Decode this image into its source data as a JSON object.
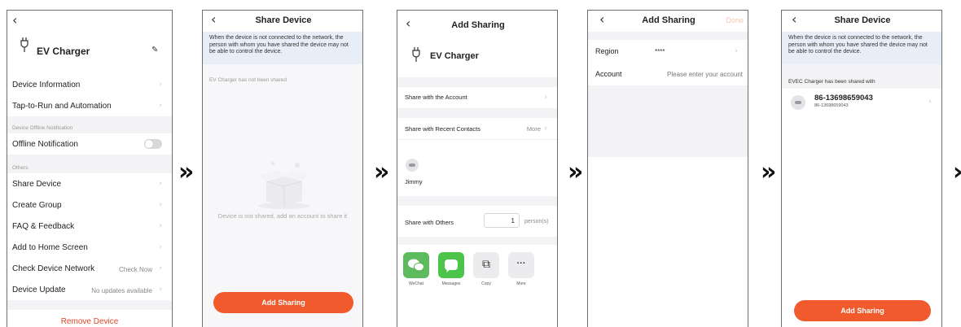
{
  "arrows": [
    "»",
    "»",
    "»",
    "»"
  ],
  "screen1": {
    "back": "‹",
    "device_name": "EV Charger",
    "edit_icon": "✎",
    "chev": "›",
    "items": [
      {
        "label": "Device Information"
      },
      {
        "label": "Tap-to-Run and Automation"
      }
    ],
    "offline_section": "Device Offline Notification",
    "offline_label": "Offline Notification",
    "others_section": "Others",
    "others": [
      {
        "label": "Share Device",
        "value": ""
      },
      {
        "label": "Create Group",
        "value": ""
      },
      {
        "label": "FAQ & Feedback",
        "value": ""
      },
      {
        "label": "Add to Home Screen",
        "value": ""
      },
      {
        "label": "Check Device Network",
        "value": "Check Now"
      },
      {
        "label": "Device Update",
        "value": "No updates available"
      }
    ],
    "remove": "Remove Device"
  },
  "screen2": {
    "back": "‹",
    "title": "Share Device",
    "notice": "When the device is not connected to the network, the person with whom you have shared the device may not be able to control the device.",
    "status": "EV Charger has not been shared",
    "empty": "Device is not shared, add an account to share it",
    "button": "Add Sharing"
  },
  "screen3": {
    "back": "‹",
    "title": "Add Sharing",
    "device_name": "EV Charger",
    "share_account": "Share with the Account",
    "recent": "Share with Recent Contacts",
    "more": "More",
    "contact": "Jimmy",
    "others": "Share with Others",
    "count": "1",
    "person": "person(s)",
    "apps": [
      {
        "label": "WeChat",
        "color": "#5dbb5d"
      },
      {
        "label": "Messages",
        "color": "#4cc44c"
      },
      {
        "label": "Copy",
        "color": "#ececef"
      },
      {
        "label": "More",
        "color": "#ececef"
      }
    ],
    "copy_glyph": "⧉",
    "more_glyph": "···"
  },
  "screen4": {
    "back": "‹",
    "title": "Add Sharing",
    "done": "Done",
    "region_label": "Region",
    "region_value": "****",
    "account_label": "Account",
    "account_placeholder": "Please enter your account"
  },
  "screen5": {
    "back": "‹",
    "title": "Share Device",
    "notice": "When the device is not connected to the network, the person with whom you have shared the device may not be able to control the device.",
    "status": "EVEC Charger has been shared with",
    "user_name": "86-13698659043",
    "user_sub": "86-13698659043",
    "button": "Add Sharing"
  },
  "colors": {
    "accent": "#f05a2c",
    "notice_bg": "#e7eef7",
    "done": "#f7c4b4"
  }
}
